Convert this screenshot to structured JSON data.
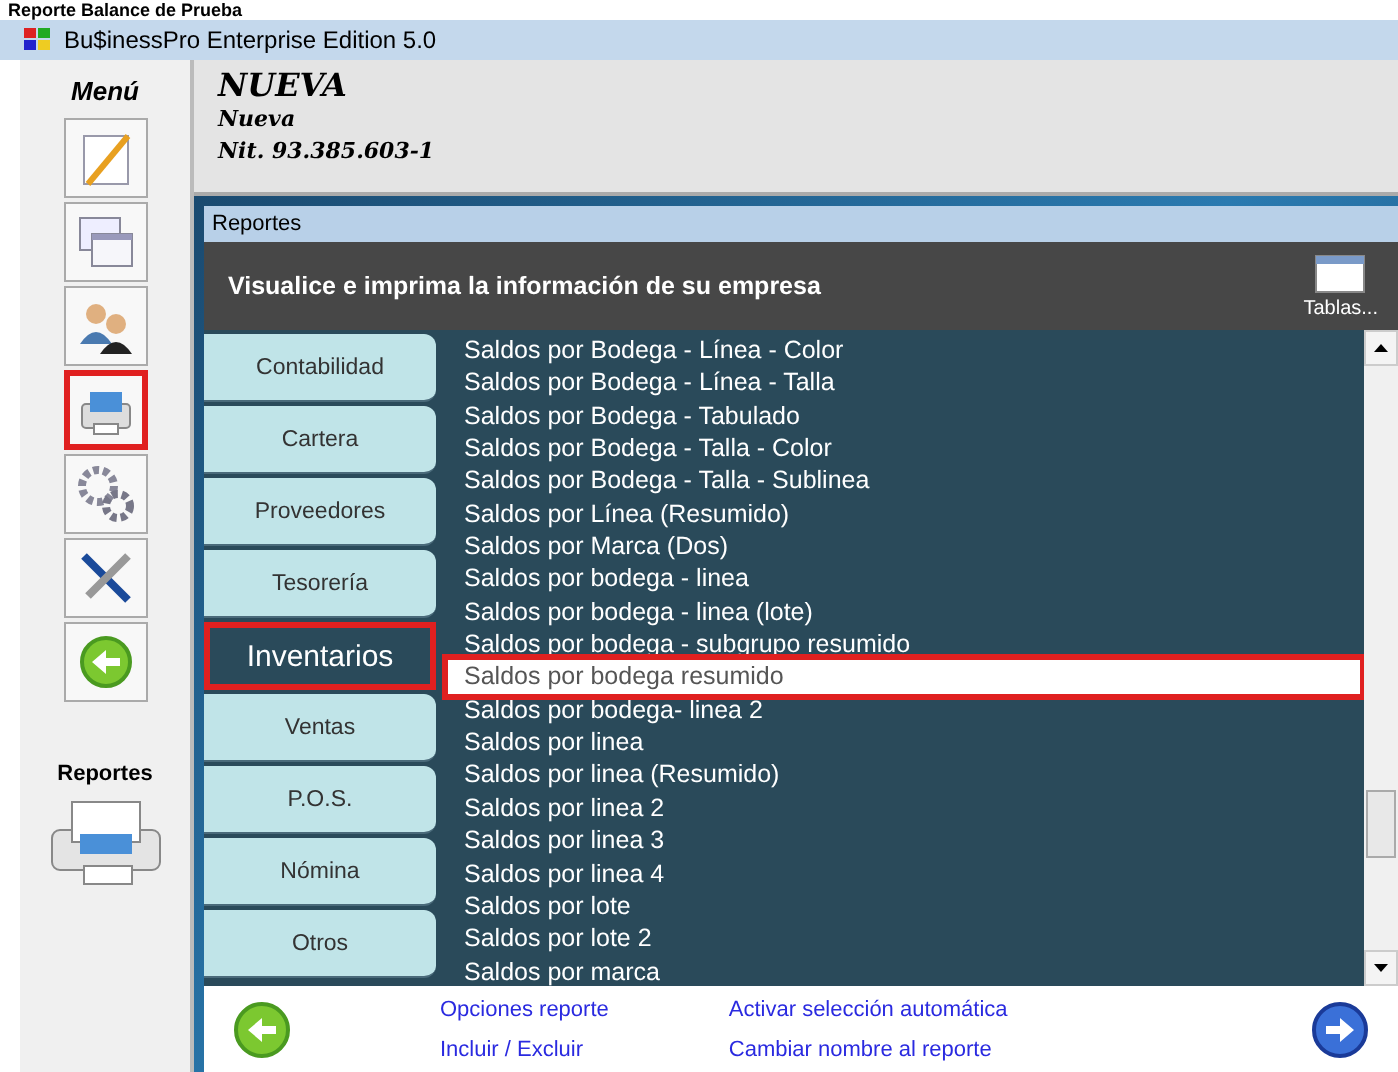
{
  "page_heading": "Reporte Balance de Prueba",
  "window": {
    "title": "Bu$inessPro Enterprise Edition 5.0"
  },
  "sidebar": {
    "title": "Menú",
    "items": [
      {
        "kind": "notepad",
        "selected": false
      },
      {
        "kind": "windows",
        "selected": false
      },
      {
        "kind": "users",
        "selected": false
      },
      {
        "kind": "printer",
        "selected": true
      },
      {
        "kind": "gears",
        "selected": false
      },
      {
        "kind": "tools",
        "selected": false
      },
      {
        "kind": "back",
        "selected": false
      }
    ],
    "section_label": "Reportes"
  },
  "company": {
    "name": "NUEVA",
    "subtitle": "Nueva",
    "nit": "Nit. 93.385.603-1"
  },
  "reports_window": {
    "title": "Reportes",
    "header": "Visualice e imprima la información de su empresa",
    "tables_button": "Tablas...",
    "tabs": [
      {
        "label": "Contabilidad",
        "selected": false
      },
      {
        "label": "Cartera",
        "selected": false
      },
      {
        "label": "Proveedores",
        "selected": false
      },
      {
        "label": "Tesorería",
        "selected": false
      },
      {
        "label": "Inventarios",
        "selected": true
      },
      {
        "label": "Ventas",
        "selected": false
      },
      {
        "label": "P.O.S.",
        "selected": false
      },
      {
        "label": "Nómina",
        "selected": false
      },
      {
        "label": "Otros",
        "selected": false
      }
    ],
    "reports": [
      {
        "label": "Saldos por Bodega - Línea - Color",
        "selected": false
      },
      {
        "label": "Saldos por Bodega - Línea - Talla",
        "selected": false
      },
      {
        "label": "Saldos por Bodega - Tabulado",
        "selected": false
      },
      {
        "label": "Saldos por Bodega - Talla - Color",
        "selected": false
      },
      {
        "label": "Saldos por Bodega - Talla - Sublinea",
        "selected": false
      },
      {
        "label": "Saldos por Línea (Resumido)",
        "selected": false
      },
      {
        "label": "Saldos por Marca (Dos)",
        "selected": false
      },
      {
        "label": "Saldos por bodega - linea",
        "selected": false
      },
      {
        "label": "Saldos por bodega - linea (lote)",
        "selected": false
      },
      {
        "label": "Saldos por bodega - subgrupo resumido",
        "selected": false
      },
      {
        "label": "Saldos por bodega resumido",
        "selected": true
      },
      {
        "label": "Saldos por bodega- linea 2",
        "selected": false
      },
      {
        "label": "Saldos por linea",
        "selected": false
      },
      {
        "label": "Saldos por linea (Resumido)",
        "selected": false
      },
      {
        "label": "Saldos por linea 2",
        "selected": false
      },
      {
        "label": "Saldos por linea 3",
        "selected": false
      },
      {
        "label": "Saldos por linea 4",
        "selected": false
      },
      {
        "label": "Saldos por lote",
        "selected": false
      },
      {
        "label": "Saldos por lote 2",
        "selected": false
      },
      {
        "label": "Saldos por marca",
        "selected": false
      }
    ],
    "links": [
      [
        "Opciones reporte",
        "Incluir / Excluir"
      ],
      [
        "Activar selección automática",
        "Cambiar nombre al reporte"
      ]
    ]
  }
}
